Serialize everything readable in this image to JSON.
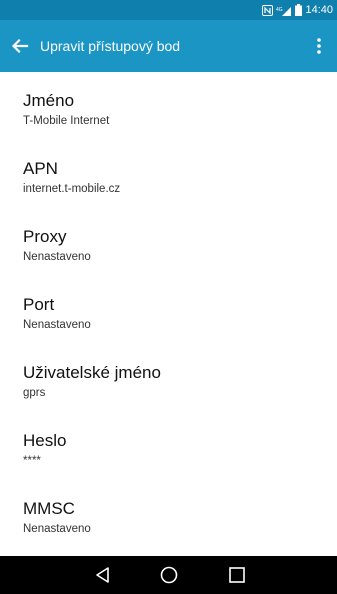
{
  "status_bar": {
    "time": "14:40",
    "icons": [
      "nfc-icon",
      "signal-icon",
      "battery-icon"
    ]
  },
  "app_bar": {
    "title": "Upravit přístupový bod",
    "back_icon": "arrow-left-icon",
    "menu_icon": "more-vert-icon"
  },
  "settings": [
    {
      "title": "Jméno",
      "value": "T-Mobile Internet"
    },
    {
      "title": "APN",
      "value": "internet.t-mobile.cz"
    },
    {
      "title": "Proxy",
      "value": "Nenastaveno"
    },
    {
      "title": "Port",
      "value": "Nenastaveno"
    },
    {
      "title": "Uživatelské jméno",
      "value": "gprs"
    },
    {
      "title": "Heslo",
      "value": "****"
    },
    {
      "title": "MMSC",
      "value": "Nenastaveno"
    }
  ],
  "nav_bar": {
    "icons": [
      "back-triangle-icon",
      "home-circle-icon",
      "recents-square-icon"
    ]
  },
  "colors": {
    "status_bar": "#0f7fad",
    "app_bar": "#1b95c4",
    "nav_bar": "#000000"
  }
}
